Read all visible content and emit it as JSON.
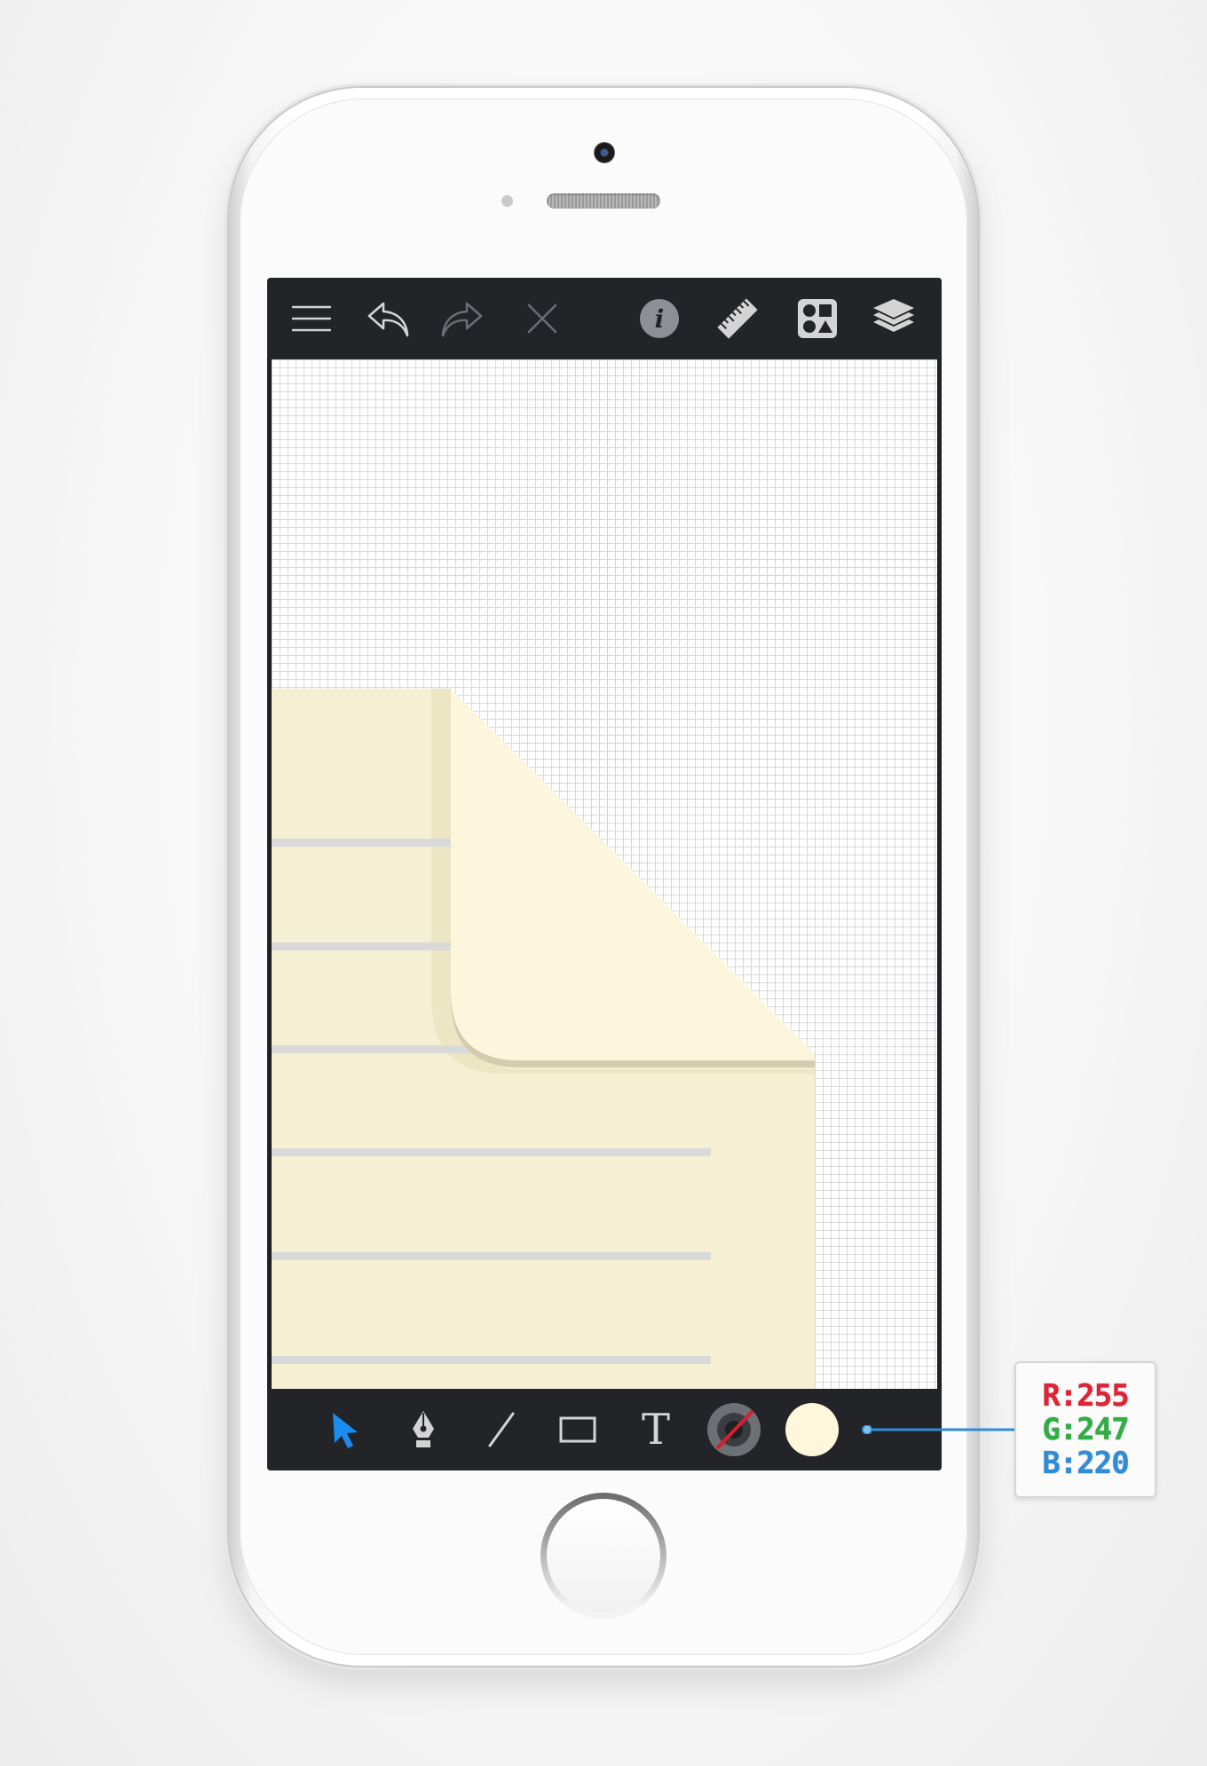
{
  "app": {
    "toolbar_top": {
      "buttons": [
        {
          "name": "menu",
          "icon": "hamburger-menu-icon",
          "enabled": true
        },
        {
          "name": "undo",
          "icon": "undo-arrow-icon",
          "enabled": true
        },
        {
          "name": "redo",
          "icon": "redo-arrow-icon",
          "enabled": false
        },
        {
          "name": "close",
          "icon": "close-x-icon",
          "enabled": false
        },
        {
          "name": "info",
          "icon": "info-icon",
          "glyph": "i",
          "enabled": true
        },
        {
          "name": "ruler",
          "icon": "ruler-icon",
          "enabled": true
        },
        {
          "name": "shapes",
          "icon": "shapes-library-icon",
          "enabled": true
        },
        {
          "name": "layers",
          "icon": "layers-icon",
          "enabled": true
        }
      ]
    },
    "toolbar_bottom": {
      "tools": [
        {
          "name": "select",
          "icon": "selection-arrow-icon",
          "active": true
        },
        {
          "name": "pen",
          "icon": "pen-nib-icon",
          "active": false
        },
        {
          "name": "line",
          "icon": "line-tool-icon",
          "active": false
        },
        {
          "name": "rectangle",
          "icon": "rectangle-tool-icon",
          "active": false
        },
        {
          "name": "text",
          "icon": "text-tool-icon",
          "glyph": "T",
          "active": false
        },
        {
          "name": "stroke",
          "icon": "stroke-color-icon",
          "active": false
        },
        {
          "name": "fill",
          "icon": "fill-color-swatch",
          "active": false
        }
      ]
    },
    "fill_color": {
      "hex": "#FFF7DC",
      "r_label": "R:255",
      "g_label": "G:247",
      "b_label": "B:220"
    },
    "colors": {
      "toolbar_bg": "#222427",
      "active_tool": "#1a8cf0",
      "paper": "#f5efd3",
      "paper_flap": "#fcf6dc",
      "paper_line": "#d9d9d9",
      "grid_line": "#d7d7d7"
    }
  }
}
